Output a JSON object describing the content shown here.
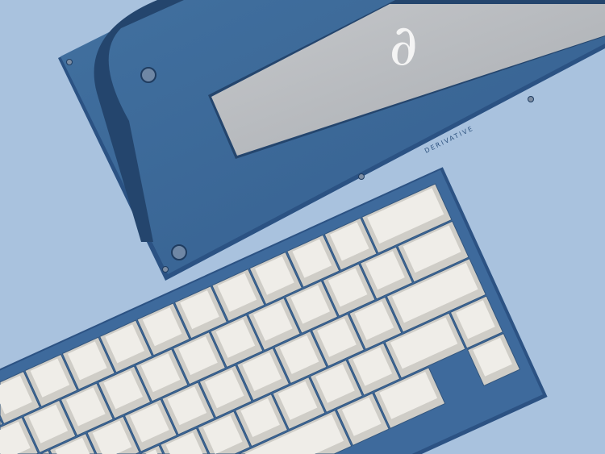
{
  "scene": {
    "logo_glyph": "∂",
    "engraving": "DERIVATIVE",
    "colors": {
      "background": "#a9c2de",
      "case": "#3e6a9c",
      "case_dark": "#24456d",
      "plate": "#b9bcc0",
      "keycap": "#e7e5df",
      "keycap_top": "#efede8"
    }
  },
  "keyboard": {
    "rows": [
      [
        2,
        1,
        1,
        1,
        1,
        1,
        1,
        1,
        1,
        1,
        1,
        1,
        1,
        1,
        1
      ],
      [
        1.5,
        1,
        1,
        1,
        1,
        1,
        1,
        1,
        1,
        1,
        1,
        1,
        1,
        1
      ],
      [
        2.25,
        1,
        1,
        1,
        1,
        1,
        1,
        1,
        1,
        1,
        1,
        1,
        1
      ],
      [
        1,
        1.75,
        1,
        1,
        1,
        1,
        1,
        1,
        1,
        1,
        1,
        1,
        1
      ],
      [
        1,
        -1,
        1.5,
        1,
        6,
        1,
        1.5
      ]
    ]
  }
}
